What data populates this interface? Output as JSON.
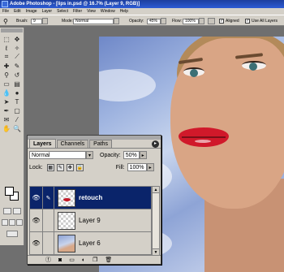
{
  "window": {
    "title": "Adobe Photoshop - [lips in.psd @ 16.7% (Layer 9, RGB)]"
  },
  "menu": {
    "items": [
      "File",
      "Edit",
      "Image",
      "Layer",
      "Select",
      "Filter",
      "View",
      "Window",
      "Help"
    ]
  },
  "options": {
    "brush_label": "Brush:",
    "brush_size": "9",
    "mode_label": "Mode:",
    "mode_value": "Normal",
    "opacity_label": "Opacity:",
    "opacity_value": "45%",
    "flow_label": "Flow:",
    "flow_value": "100%",
    "aligned_label": "Aligned",
    "use_all_layers_label": "Use All Layers"
  },
  "layers_panel": {
    "tabs": [
      {
        "label": "Layers",
        "active": true
      },
      {
        "label": "Channels",
        "active": false
      },
      {
        "label": "Paths",
        "active": false
      }
    ],
    "blend_mode": "Normal",
    "opacity_label": "Opacity:",
    "opacity_value": "50%",
    "lock_label": "Lock:",
    "fill_label": "Fill:",
    "fill_value": "100%",
    "layers": [
      {
        "name": "retouch",
        "selected": true
      },
      {
        "name": "Layer 9",
        "selected": false
      },
      {
        "name": "Layer 6",
        "selected": false
      }
    ]
  },
  "colors": {
    "selection": "#0a246a",
    "panel": "#d4d0c8",
    "title_bar": "#2c5bd4",
    "lips": "#d0192a"
  }
}
